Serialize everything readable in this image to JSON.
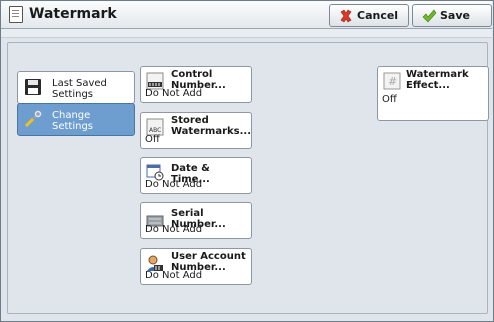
{
  "window": {
    "title": "Watermark"
  },
  "header": {
    "cancel_label": "Cancel",
    "save_label": "Save"
  },
  "left_menu": {
    "items": [
      {
        "label_line1": "Last Saved",
        "label_line2": "Settings",
        "icon": "floppy-disk-icon",
        "selected": false
      },
      {
        "label_line1": "Change",
        "label_line2": "Settings",
        "icon": "tools-icon",
        "selected": true
      }
    ]
  },
  "options": {
    "control_number": {
      "label_line1": "Control",
      "label_line2": "Number...",
      "value": "Do Not Add",
      "icon": "number-counter-icon"
    },
    "stored_watermarks": {
      "label_line1": "Stored",
      "label_line2": "Watermarks...",
      "value": "Off",
      "icon": "abc-stamp-icon"
    },
    "date_time": {
      "label": "Date & Time...",
      "value": "Do Not Add",
      "icon": "calendar-clock-icon"
    },
    "serial_number": {
      "label": "Serial Number...",
      "value": "Do Not Add",
      "icon": "serial-number-icon"
    },
    "user_account_number": {
      "label_line1": "User Account",
      "label_line2": "Number...",
      "value": "Do Not Add",
      "icon": "user-account-icon"
    },
    "watermark_effect": {
      "label_line1": "Watermark",
      "label_line2": "Effect...",
      "value": "Off",
      "icon": "hash-watermark-icon"
    }
  },
  "colors": {
    "selected_tile": "#6e9ed0",
    "cancel_icon": "#d93a2a",
    "save_icon": "#6fb82a"
  }
}
